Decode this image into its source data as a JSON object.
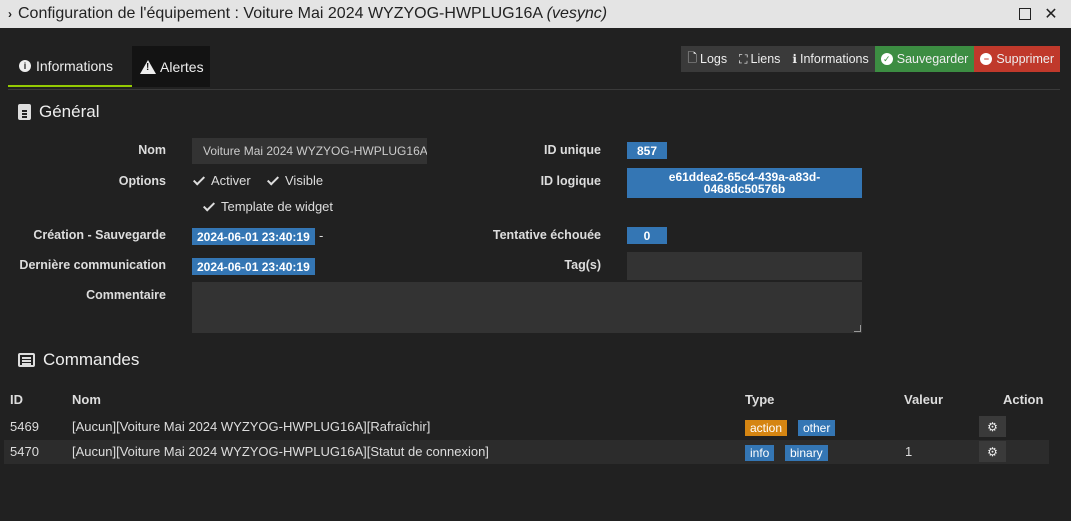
{
  "window": {
    "title_main": "Configuration de l'équipement : Voiture Mai 2024 WYZYOG-HWPLUG16A ",
    "title_plugin": "(vesync)",
    "collapse_glyph": "›",
    "close_glyph": "✕"
  },
  "tabs": [
    {
      "label": "Informations",
      "icon": "info-circle-icon"
    },
    {
      "label": "Alertes",
      "icon": "warning-triangle-icon"
    }
  ],
  "toolbar": {
    "logs": "Logs",
    "liens": "Liens",
    "informations": "Informations",
    "sauvegarder": "Sauvegarder",
    "supprimer": "Supprimer"
  },
  "general": {
    "title": "Général",
    "nom_label": "Nom",
    "nom_value": "Voiture Mai 2024 WYZYOG-HWPLUG16A",
    "options_label": "Options",
    "opt_activer": "Activer",
    "opt_visible": "Visible",
    "opt_template": "Template de widget",
    "creation_label": "Création - Sauvegarde",
    "creation_value": "2024-06-01 23:40:19",
    "creation_sep": "-",
    "derniere_label": "Dernière communication",
    "derniere_value": "2024-06-01 23:40:19",
    "commentaire_label": "Commentaire",
    "id_unique_label": "ID unique",
    "id_unique_value": "857",
    "id_logique_label": "ID logique",
    "id_logique_value": "e61ddea2-65c4-439a-a83d-0468dc50576b",
    "tentative_label": "Tentative échouée",
    "tentative_value": "0",
    "tags_label": "Tag(s)"
  },
  "commandes": {
    "title": "Commandes",
    "headers": {
      "id": "ID",
      "nom": "Nom",
      "type": "Type",
      "valeur": "Valeur",
      "action": "Action"
    },
    "rows": [
      {
        "id": "5469",
        "nom": "[Aucun][Voiture Mai 2024 WYZYOG-HWPLUG16A][Rafraîchir]",
        "type": "action",
        "subtype": "other",
        "valeur": ""
      },
      {
        "id": "5470",
        "nom": "[Aucun][Voiture Mai 2024 WYZYOG-HWPLUG16A][Statut de connexion]",
        "type": "info",
        "subtype": "binary",
        "valeur": "1"
      }
    ]
  },
  "colors": {
    "accent_green": "#94ca02",
    "save_green": "#3c8d42",
    "delete_red": "#c0392b",
    "badge_blue": "#3476b4",
    "tag_orange": "#d58512"
  }
}
